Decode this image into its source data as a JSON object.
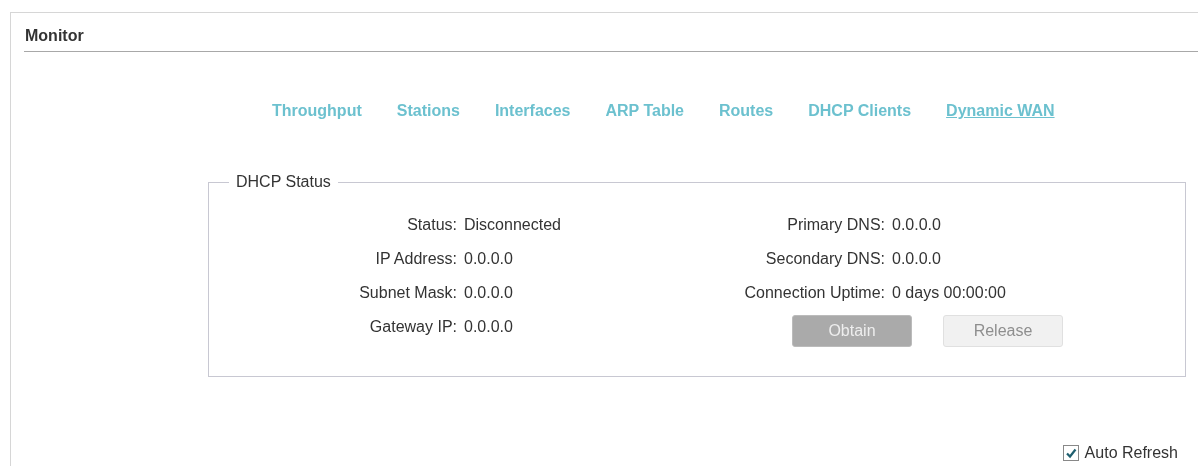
{
  "panel": {
    "title": "Monitor"
  },
  "tabs": [
    {
      "label": "Throughput",
      "selected": false
    },
    {
      "label": "Stations",
      "selected": false
    },
    {
      "label": "Interfaces",
      "selected": false
    },
    {
      "label": "ARP Table",
      "selected": false
    },
    {
      "label": "Routes",
      "selected": false
    },
    {
      "label": "DHCP Clients",
      "selected": false
    },
    {
      "label": "Dynamic WAN",
      "selected": true
    }
  ],
  "dhcp_status": {
    "legend": "DHCP Status",
    "left_fields": [
      {
        "label": "Status:",
        "value": "Disconnected"
      },
      {
        "label": "IP Address:",
        "value": "0.0.0.0"
      },
      {
        "label": "Subnet Mask:",
        "value": "0.0.0.0"
      },
      {
        "label": "Gateway IP:",
        "value": "0.0.0.0"
      }
    ],
    "right_fields": [
      {
        "label": "Primary DNS:",
        "value": "0.0.0.0"
      },
      {
        "label": "Secondary DNS:",
        "value": "0.0.0.0"
      },
      {
        "label": "Connection Uptime:",
        "value": "0 days 00:00:00"
      }
    ],
    "buttons": [
      {
        "label": "Obtain",
        "disabled": false
      },
      {
        "label": "Release",
        "disabled": true
      }
    ]
  },
  "auto_refresh": {
    "label": "Auto Refresh",
    "checked": true
  }
}
